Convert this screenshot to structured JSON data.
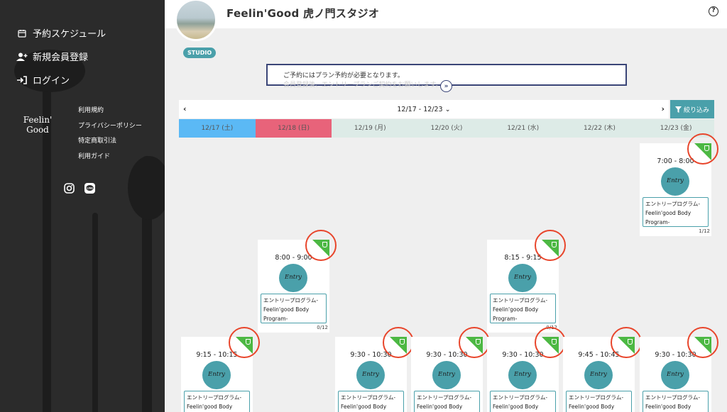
{
  "sidebar": {
    "menu": [
      {
        "label": "予約スケジュール",
        "icon": "calendar-icon"
      },
      {
        "label": "新規会員登録",
        "icon": "add-user-icon"
      },
      {
        "label": "ログイン",
        "icon": "login-icon"
      }
    ],
    "logo": {
      "line1": "Feelin'",
      "line2": "Good"
    },
    "links": [
      "利用規約",
      "プライバシーポリシー",
      "特定商取引法",
      "利用ガイド"
    ],
    "social": [
      "instagram-icon",
      "line-icon"
    ]
  },
  "header": {
    "studio_name": "Feelin'Good 虎ノ門スタジオ",
    "help_icon": "?"
  },
  "studio_badge": "STUDIO",
  "notice": {
    "text": "ご予約にはプラン予約が必要となります。",
    "sub": "会員登録後、エントリープランご契約をお願いします。"
  },
  "week": {
    "range": "12/17 - 12/23",
    "filter_label": "絞り込み",
    "days": [
      {
        "label": "12/17 (土)",
        "bg": "#5bb9f5"
      },
      {
        "label": "12/18 (日)",
        "bg": "#e8637a"
      },
      {
        "label": "12/19 (月)",
        "bg": "#ddebe7"
      },
      {
        "label": "12/20 (火)",
        "bg": "#ddebe7"
      },
      {
        "label": "12/21 (水)",
        "bg": "#ddebe7"
      },
      {
        "label": "12/22 (木)",
        "bg": "#ddebe7"
      },
      {
        "label": "12/23 (金)",
        "bg": "#ddebe7"
      }
    ]
  },
  "lessons": [
    {
      "time": "7:00 - 8:00",
      "thumb": "Entry",
      "program": "エントリープログラム-Feelin'good Body Program-",
      "capacity": "1/12"
    },
    {
      "time": "8:00 - 9:00",
      "thumb": "Entry",
      "program": "エントリープログラム-Feelin'good Body Program-",
      "capacity": "0/12"
    },
    {
      "time": "8:15 - 9:15",
      "thumb": "Entry",
      "program": "エントリープログラム-Feelin'good Body Program-",
      "capacity": "0/12"
    },
    {
      "time": "9:15 - 10:15",
      "thumb": "Entry",
      "program": "エントリープログラム-Feelin'good Body Program-",
      "capacity": ""
    },
    {
      "time": "9:30 - 10:30",
      "thumb": "Entry",
      "program": "エントリープログラム-Feelin'good Body Program-",
      "capacity": ""
    },
    {
      "time": "9:30 - 10:30",
      "thumb": "Entry",
      "program": "エントリープログラム-Feelin'good Body Program-",
      "capacity": ""
    },
    {
      "time": "9:30 - 10:30",
      "thumb": "Entry",
      "program": "エントリープログラム-Feelin'good Body Program-",
      "capacity": ""
    },
    {
      "time": "9:45 - 10:45",
      "thumb": "Entry",
      "program": "エントリープログラム-Feelin'good Body Program-",
      "capacity": ""
    },
    {
      "time": "9:30 - 10:30",
      "thumb": "Entry",
      "program": "エントリープログラム-Feelin'good Body Program-",
      "capacity": ""
    }
  ]
}
